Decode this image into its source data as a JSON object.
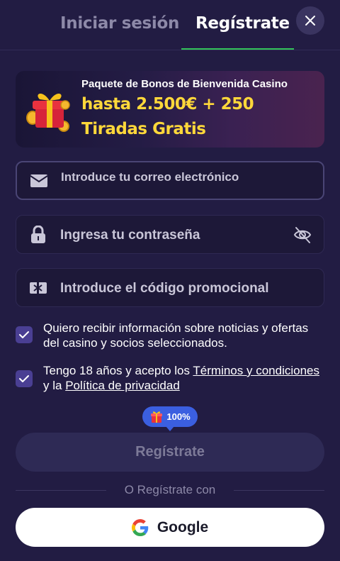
{
  "tabs": {
    "login": "Iniciar sesión",
    "register": "Regístrate",
    "active": "register"
  },
  "banner": {
    "subtitle": "Paquete de Bonos de Bienvenida Casino",
    "headline_line1": "hasta 2.500€ + 250",
    "headline_line2": "Tiradas Gratis",
    "icon": "gift-box-icon"
  },
  "form": {
    "email_placeholder": "Introduce tu correo electrónico",
    "password_placeholder": "Ingresa tu contraseña",
    "promo_placeholder": "Introduce el código promocional"
  },
  "checkboxes": {
    "newsletter": {
      "checked": true,
      "text": "Quiero recibir información sobre noticias y ofertas del casino y socios seleccionados."
    },
    "terms": {
      "checked": true,
      "prefix": "Tengo 18 años y acepto los ",
      "terms_link": "Términos y condiciones",
      "middle": " y la ",
      "privacy_link": "Política de privacidad"
    }
  },
  "bonus_badge": {
    "percent": "100%",
    "icon": "gift-icon"
  },
  "register_button": "Regístrate",
  "divider_text": "O Regístrate con",
  "google_button": "Google",
  "colors": {
    "background": "#221c43",
    "accent_green": "#33c35a",
    "banner_text_yellow": "#ffd83a",
    "badge_blue": "#3b5fe0",
    "checkbox_purple": "#4a3f93"
  }
}
